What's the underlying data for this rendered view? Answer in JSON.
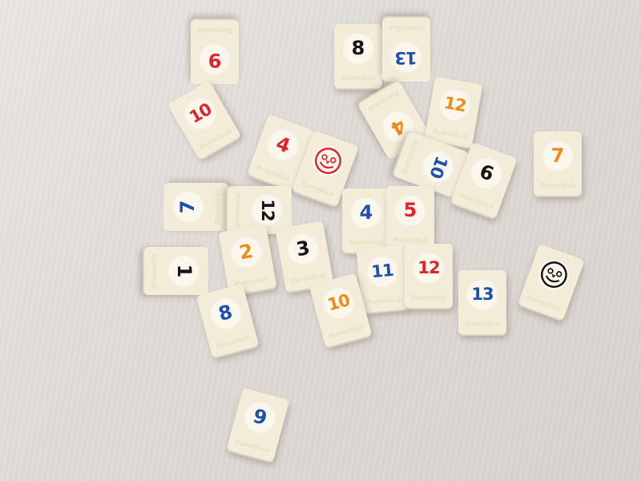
{
  "brand": "Rummikub",
  "colors": {
    "red": "#e0242e",
    "blue": "#1e4fb0",
    "orange": "#f08a1c",
    "black": "#141414",
    "tile": "#f3ecd9",
    "table": "#e3dedb"
  },
  "tiles": [
    {
      "value": "9",
      "color": "red"
    },
    {
      "value": "8",
      "color": "black"
    },
    {
      "value": "13",
      "color": "blue"
    },
    {
      "value": "10",
      "color": "red"
    },
    {
      "value": "4",
      "color": "orange"
    },
    {
      "value": "12",
      "color": "orange"
    },
    {
      "value": "4",
      "color": "red"
    },
    {
      "value": "joker",
      "color": "red"
    },
    {
      "value": "10",
      "color": "blue"
    },
    {
      "value": "6",
      "color": "black"
    },
    {
      "value": "7",
      "color": "orange"
    },
    {
      "value": "7",
      "color": "blue"
    },
    {
      "value": "12",
      "color": "black"
    },
    {
      "value": "4",
      "color": "blue"
    },
    {
      "value": "5",
      "color": "red"
    },
    {
      "value": "1",
      "color": "black"
    },
    {
      "value": "2",
      "color": "orange"
    },
    {
      "value": "3",
      "color": "black"
    },
    {
      "value": "11",
      "color": "blue"
    },
    {
      "value": "12",
      "color": "red"
    },
    {
      "value": "13",
      "color": "blue"
    },
    {
      "value": "joker",
      "color": "black"
    },
    {
      "value": "8",
      "color": "blue"
    },
    {
      "value": "10",
      "color": "orange"
    },
    {
      "value": "9",
      "color": "blue"
    }
  ]
}
